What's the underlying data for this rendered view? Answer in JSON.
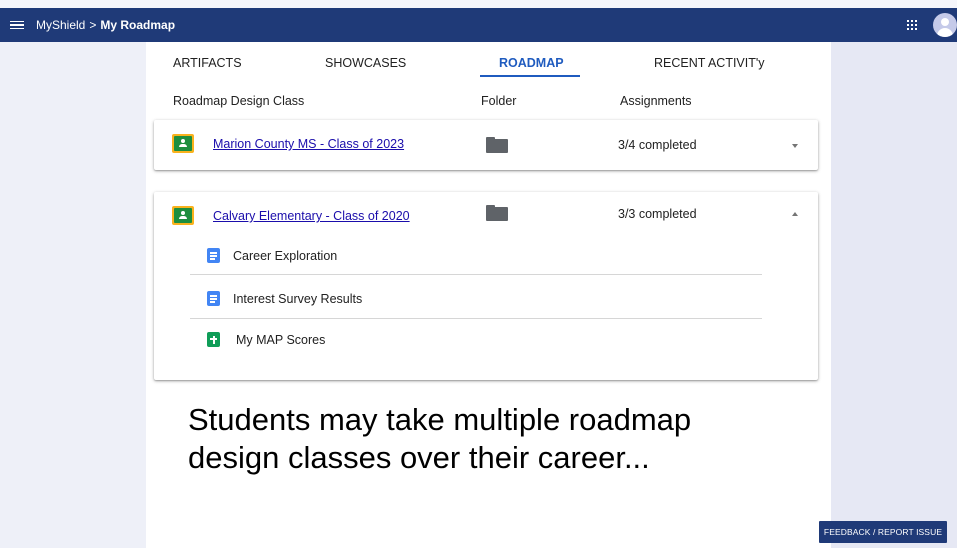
{
  "appbar": {
    "breadcrumb_root": "MyShield",
    "breadcrumb_sep": ">",
    "breadcrumb_current": "My Roadmap"
  },
  "tabs": [
    {
      "label": "ARTIFACTS"
    },
    {
      "label": "SHOWCASES"
    },
    {
      "label": "ROADMAP",
      "active": true
    },
    {
      "label": "RECENT ACTIVIT'y"
    }
  ],
  "columns": {
    "class": "Roadmap Design Class",
    "folder": "Folder",
    "assignments": "Assignments"
  },
  "classes": [
    {
      "name": "Marion County MS - Class of 2023",
      "status": "3/4 completed",
      "expanded": false
    },
    {
      "name": "Calvary Elementary - Class of 2020",
      "status": "3/3 completed",
      "expanded": true,
      "items": [
        {
          "label": "Career Exploration",
          "icon": "docs-icon"
        },
        {
          "label": "Interest Survey Results",
          "icon": "docs-icon"
        },
        {
          "label": "My MAP Scores",
          "icon": "sheets-icon"
        }
      ]
    }
  ],
  "caption": "Students may take multiple roadmap design classes over their career...",
  "feedback_button": "FEEDBACK / REPORT ISSUE",
  "colors": {
    "appbar": "#1f3a78",
    "accent": "#1f5bbf",
    "link": "#1a0dab"
  }
}
